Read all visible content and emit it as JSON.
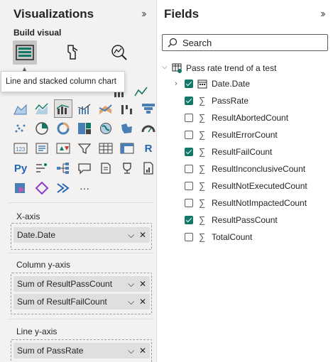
{
  "visualizations": {
    "title": "Visualizations",
    "collapse_icon": "chevrons-right-icon",
    "build_label": "Build visual",
    "tooltip": "Line and stacked column chart"
  },
  "wells": {
    "x_axis": {
      "label": "X-axis",
      "fields": [
        "Date.Date"
      ]
    },
    "column_y_axis": {
      "label": "Column y-axis",
      "fields": [
        "Sum of ResultPassCount",
        "Sum of ResultFailCount"
      ]
    },
    "line_y_axis": {
      "label": "Line y-axis",
      "fields": [
        "Sum of PassRate"
      ]
    }
  },
  "fields": {
    "title": "Fields",
    "collapse_icon": "chevrons-right-icon",
    "search_placeholder": "Search",
    "table_name": "Pass rate trend of a test",
    "items": [
      {
        "name": "Date.Date",
        "checked": true,
        "kind": "date"
      },
      {
        "name": "PassRate",
        "checked": true,
        "kind": "sum"
      },
      {
        "name": "ResultAbortedCount",
        "checked": false,
        "kind": "sum"
      },
      {
        "name": "ResultErrorCount",
        "checked": false,
        "kind": "sum"
      },
      {
        "name": "ResultFailCount",
        "checked": true,
        "kind": "sum"
      },
      {
        "name": "ResultInconclusiveCount",
        "checked": false,
        "kind": "sum"
      },
      {
        "name": "ResultNotExecutedCount",
        "checked": false,
        "kind": "sum"
      },
      {
        "name": "ResultNotImpactedCount",
        "checked": false,
        "kind": "sum"
      },
      {
        "name": "ResultPassCount",
        "checked": true,
        "kind": "sum"
      },
      {
        "name": "TotalCount",
        "checked": false,
        "kind": "sum"
      }
    ]
  },
  "colors": {
    "accent": "#117865",
    "pane_bg": "#f3f2f1",
    "chip_bg": "#e1dfdd"
  }
}
